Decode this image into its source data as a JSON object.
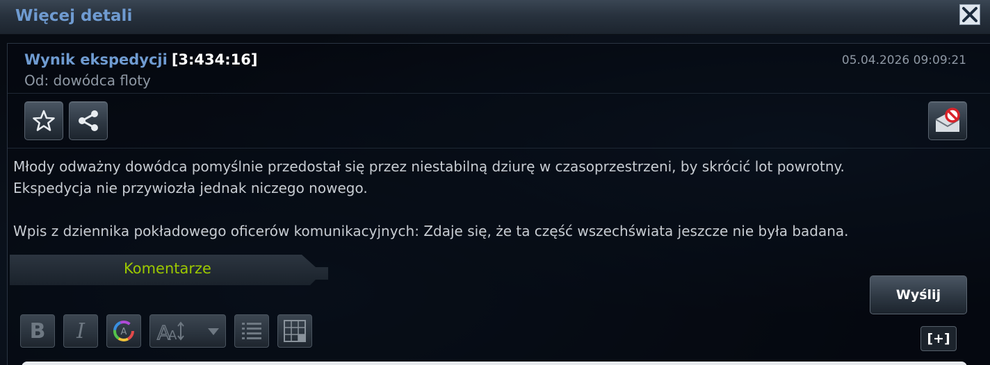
{
  "window": {
    "title": "Więcej detali",
    "close_icon": "close-x-icon"
  },
  "message": {
    "subject_title": "Wynik ekspedycji",
    "subject_coords": "[3:434:16]",
    "sender": "Od: dowódca floty",
    "date": "05.04.2026 09:09:21",
    "actions": {
      "favorite_icon": "star-icon",
      "share_icon": "share-icon",
      "block_icon": "mail-block-icon"
    },
    "body": [
      "Młody odważny dowódca pomyślnie przedostał się przez niestabilną dziurę w czasoprzestrzeni, by skrócić lot powrotny.",
      "Ekspedycja nie przywiozła jednak niczego nowego.",
      "Wpis z dziennika pokładowego oficerów komunikacyjnych: Zdaje się, że ta część wszechświata jeszcze nie była badana."
    ]
  },
  "comments": {
    "tab_label": "Komentarze",
    "send_label": "Wyślij",
    "expand_label": "[+]",
    "editor": {
      "bold_label": "B",
      "italic_label": "I",
      "color_icon": "color-wheel-icon",
      "font_size_icon": "font-size-icon",
      "list_icon": "list-icon",
      "table_icon": "table-grid-icon"
    }
  },
  "colors": {
    "title_blue": "#6f9bd1",
    "accent_green": "#9cc800",
    "text_grey": "#c7ccd2"
  }
}
